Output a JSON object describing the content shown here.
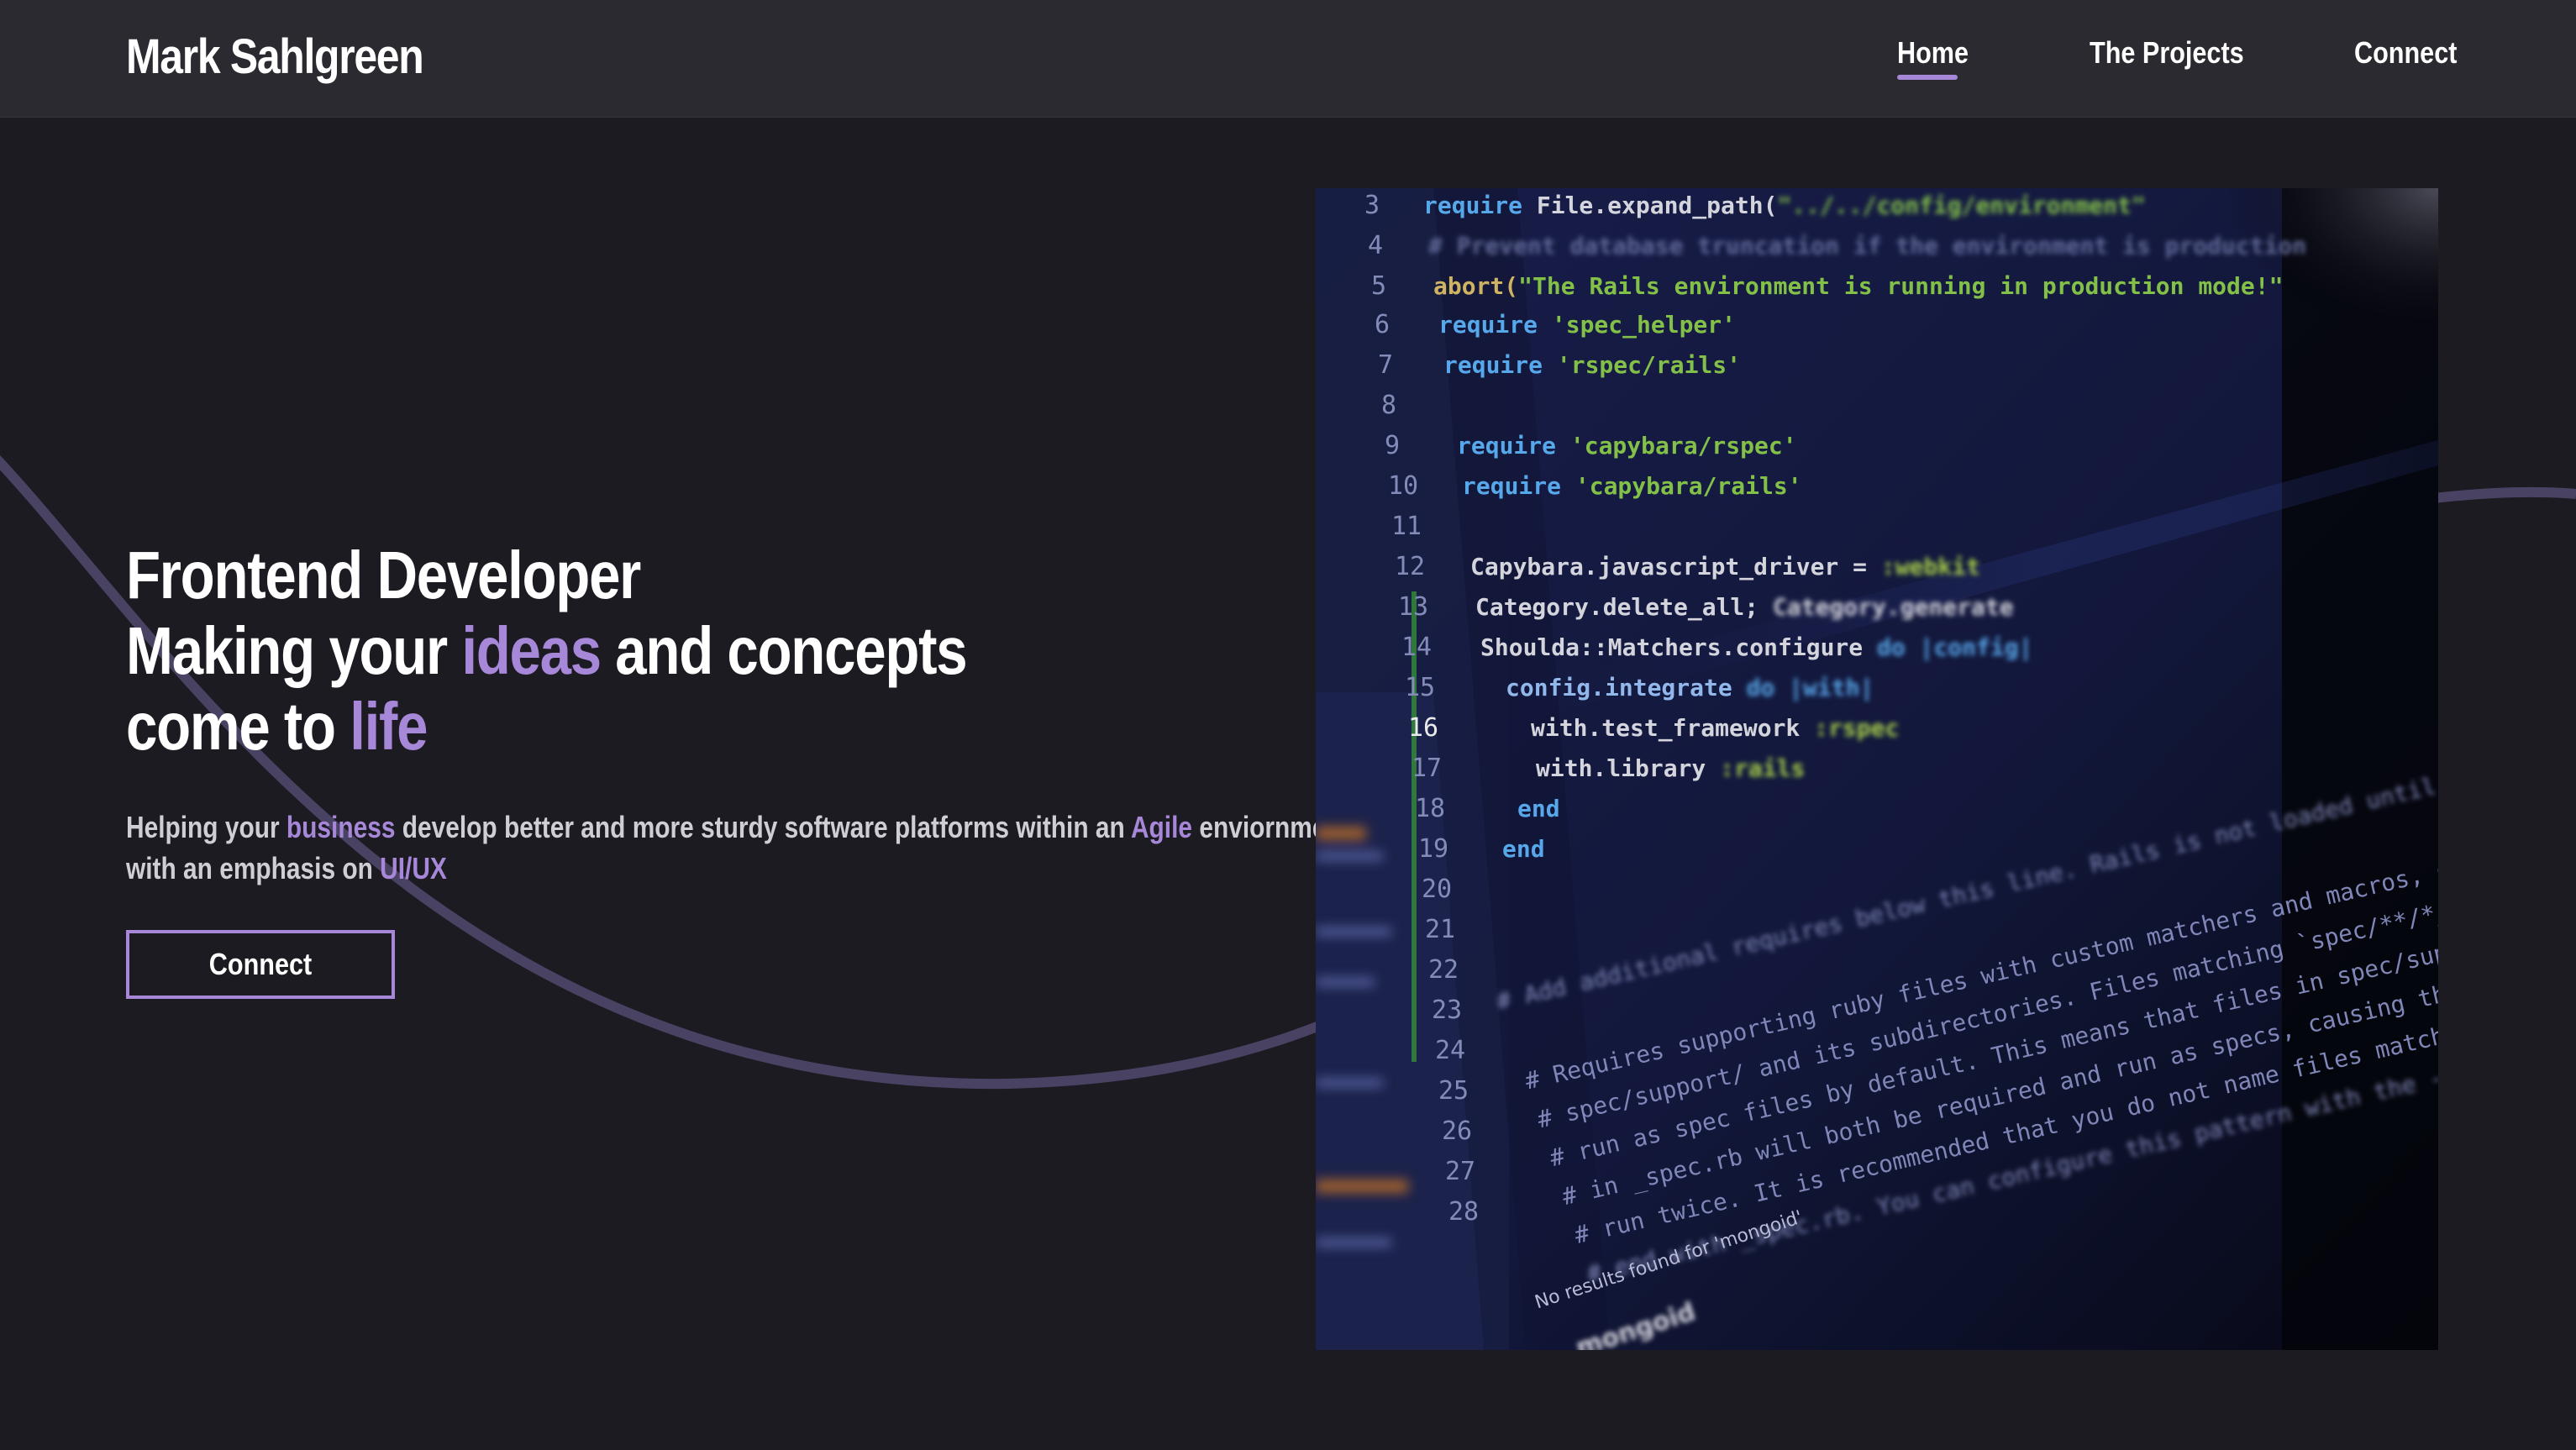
{
  "nav": {
    "brand": "Mark Sahlgreen",
    "links": [
      "Home",
      "The Projects",
      "Connect"
    ],
    "active": "Home"
  },
  "hero": {
    "title_line1": "Frontend Developer",
    "title_line2_a": "Making your ",
    "title_line2_accent": "ideas",
    "title_line2_b": " and concepts",
    "title_line3_a": "come to ",
    "title_line3_accent": "life",
    "sub_line1_a": "Helping your ",
    "sub_line1_accent1": "business",
    "sub_line1_b": " develop better and more sturdy software platforms within an ",
    "sub_line1_accent2": "Agile",
    "sub_line1_c": " enviornment,",
    "sub_line2_a": "with an emphasis on ",
    "sub_line2_accent": "UI/UX",
    "cta_label": "Connect"
  },
  "code_image": {
    "line_numbers": [
      "3",
      "4",
      "5",
      "6",
      "7",
      "8",
      "9",
      "10",
      "11",
      "12",
      "13",
      "14",
      "15",
      "16",
      "17",
      "18",
      "19",
      "20",
      "21",
      "22",
      "23",
      "24",
      "25",
      "26",
      "27",
      "28"
    ],
    "lines": [
      "require File.expand_path(\"../../config/environment\", __FILE__)",
      "# Prevent database truncation if the environment is production",
      "abort(\"The Rails environment is running in production mode!\") if Rails.env.production?",
      "require 'spec_helper'",
      "require 'rspec/rails'",
      "",
      "require 'capybara/rspec'",
      "require 'capybara/rails'",
      "",
      "Capybara.javascript_driver = :webkit",
      "Category.delete_all; Category.generate",
      "Shoulda::Matchers.configure do |config|",
      "config.integrate do |with|",
      "with.test_framework :rspec",
      "with.library :rails",
      "end",
      "end",
      "",
      "# Add additional requires below this line. Rails is not loaded until this point!",
      "",
      "# Requires supporting ruby files with custom matchers and macros, etc, in",
      "# spec/support/ and its subdirectories. Files matching `spec/**/*_spec.rb` are",
      "# run as spec files by default. This means that files in spec/support that end",
      "# in _spec.rb will both be required and run as specs, causing the specs to be",
      "# run twice. It is recommended that you do not name files matching this glob to",
      "# end with _spec.rb. You can configure this pattern with the --pattern"
    ],
    "status_text": "No results found for 'mongoid'",
    "bottom_text": "mongoid",
    "sidebar_files": [
      "cart_feature_spec",
      "order_feature_spec",
      "example_genres.png",
      "products.rb",
      "order_helper.rb"
    ]
  },
  "colors": {
    "accent": "#a787d8",
    "background": "#1c1b22",
    "navbar": "#2b2a31",
    "arc": "#4a4263"
  }
}
